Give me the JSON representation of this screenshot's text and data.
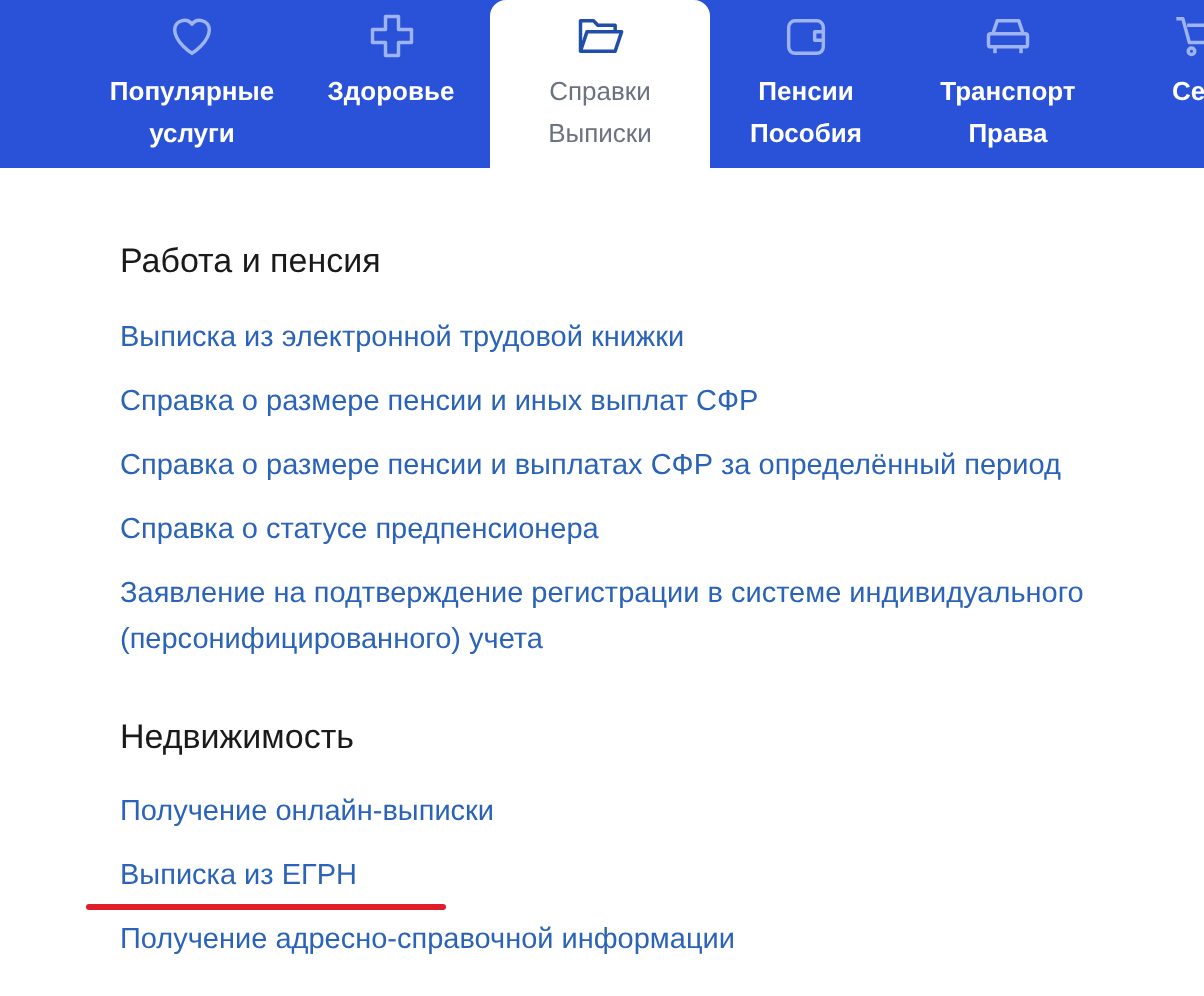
{
  "tabs": [
    {
      "label": "Популярные услуги",
      "selected": false
    },
    {
      "label": "Здоровье",
      "selected": false
    },
    {
      "label": "Справки Выписки",
      "selected": true
    },
    {
      "label": "Пенсии Пособия",
      "selected": false
    },
    {
      "label": "Транспорт Права",
      "selected": false
    },
    {
      "label": "Се",
      "selected": false
    }
  ],
  "sections": [
    {
      "title": "Работа и пенсия",
      "links": [
        {
          "text": "Выписка из электронной трудовой книжки",
          "underlined": false
        },
        {
          "text": "Справка о размере пенсии и иных выплат СФР",
          "underlined": false
        },
        {
          "text": "Справка о размере пенсии и выплатах СФР за определённый период",
          "underlined": false
        },
        {
          "text": "Справка о статусе предпенсионера",
          "underlined": false
        },
        {
          "text": "Заявление на подтверждение регистрации в системе индивидуального (персонифицированного) учета",
          "underlined": false
        }
      ]
    },
    {
      "title": "Недвижимость",
      "links": [
        {
          "text": "Получение онлайн-выписки",
          "underlined": false
        },
        {
          "text": "Выписка из ЕГРН",
          "underlined": true
        },
        {
          "text": "Получение адресно-справочной информации",
          "underlined": false
        }
      ]
    }
  ]
}
